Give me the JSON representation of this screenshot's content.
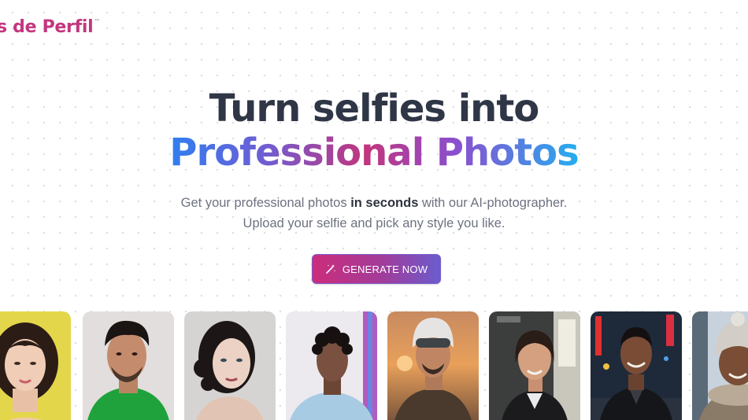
{
  "header": {
    "brand": "s de Perfil",
    "trademark": "™",
    "brand_color": "#c3367f"
  },
  "hero": {
    "title_line1": "Turn selfies into",
    "title_line2": "Professional Photos",
    "subtitle_part1": "Get your professional photos ",
    "subtitle_bold": "in seconds",
    "subtitle_part2": " with our AI-photographer.",
    "subtitle_line2": "Upload your selfie and pick any style you like.",
    "cta_label": "GENERATE NOW",
    "cta_icon": "magic-wand-icon"
  },
  "colors": {
    "title_dark": "#2f3646",
    "gradient_start": "#2f7ff0",
    "gradient_mid": "#c2357e",
    "gradient_end": "#24aef0",
    "cta_start": "#cc2d7b",
    "cta_end": "#6a5ccd"
  }
}
